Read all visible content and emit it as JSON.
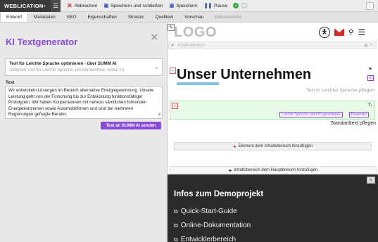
{
  "app": {
    "brand": "WEBLICATION",
    "brand_mark": "®",
    "colors": {
      "accent": "#8a4ad8",
      "danger": "#d52a2a",
      "toolbar_dark": "#3a3a3a",
      "footer_dark": "#2b2b2b"
    }
  },
  "toolbar": {
    "buttons": [
      {
        "label": "Abbrechen",
        "icon": "close-icon"
      },
      {
        "label": "Speichern und schließen",
        "icon": "save-close-icon"
      },
      {
        "label": "Speichern",
        "icon": "save-icon"
      },
      {
        "label": "Pause",
        "icon": "pause-icon"
      }
    ],
    "status_icons": [
      "check-icon",
      "circle-icon"
    ]
  },
  "tabs": [
    {
      "label": "Entwurf",
      "active": true
    },
    {
      "label": "Metadaten"
    },
    {
      "label": "SEO"
    },
    {
      "label": "Eigenschaften"
    },
    {
      "label": "Struktur"
    },
    {
      "label": "Quelltext"
    },
    {
      "label": "Vorschau"
    },
    {
      "label": "Editoransicht",
      "disabled": true
    }
  ],
  "ki_panel": {
    "title": "KI Textgenerator",
    "prompt_select": {
      "selected": "Text für Leichte Sprache optimieren - über SUMM AI",
      "description": "Optimiert Text für Leichte Sprache, um barrierefreie Seiten zu"
    },
    "text_label": "Text",
    "text_value": "Wir entwickeln Lösungen im Bereich alternative Energiegewinnung. Unsere Leistung geht von der Forschung bis zur Entwicklung funktionsfähiger Prototypen. Wir haben Kooperationen mit nahezu sämtlichen führenden Energiekonzernen sowie Automobilfirmen und sind bei mehreren Regierungen gefragte Berater.",
    "submit_label": "Text an SUMM AI senden"
  },
  "preview": {
    "logo": "LOGO",
    "breadcrumb": "Inhaltsbereich",
    "headline": "Unser Unternehmen",
    "headline_hint": "Text in Leichter Sprache pflegen",
    "ki_badge": "KI",
    "chip_generate": "Leichte Sprache über KI generieren",
    "chip_rate": "Bewerten",
    "standard_text": "Standardtext pflegen",
    "add_element": "Element dem Inhaltsbereich hinzufügen",
    "add_area": "Inhaltsbereich dem Hauptbereich hinzufügen",
    "footer": {
      "title": "Infos zum Demoprojekt",
      "links": [
        "Quick-Start-Guide",
        "Online-Dokumentation",
        "Entwicklerbereich"
      ]
    }
  }
}
